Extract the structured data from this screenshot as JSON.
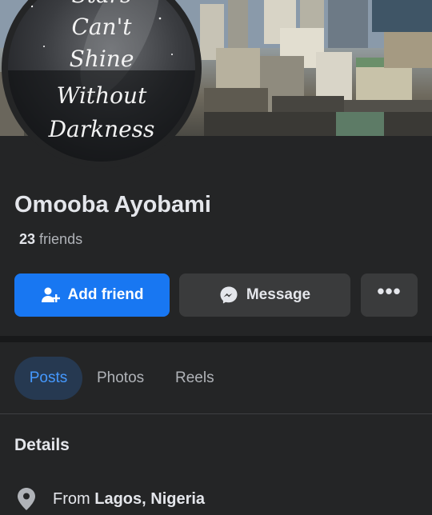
{
  "profile": {
    "avatar_quote": [
      "Stars",
      "Can't",
      "Shine",
      "Without",
      "Darkness"
    ],
    "name": "Omooba Ayobami",
    "friends_count": "23",
    "friends_label": "friends"
  },
  "actions": {
    "add_friend": "Add friend",
    "message": "Message",
    "more": "•••"
  },
  "tabs": [
    {
      "label": "Posts",
      "active": true
    },
    {
      "label": "Photos",
      "active": false
    },
    {
      "label": "Reels",
      "active": false
    }
  ],
  "details": {
    "heading": "Details",
    "from_prefix": "From",
    "from_place": "Lagos, Nigeria"
  },
  "colors": {
    "accent": "#1877f2",
    "background": "#242526",
    "active_tab_bg": "#263951",
    "active_tab_text": "#4599ff"
  },
  "icons": {
    "add_friend": "add-friend-icon",
    "message": "messenger-icon",
    "location": "location-pin-icon"
  }
}
